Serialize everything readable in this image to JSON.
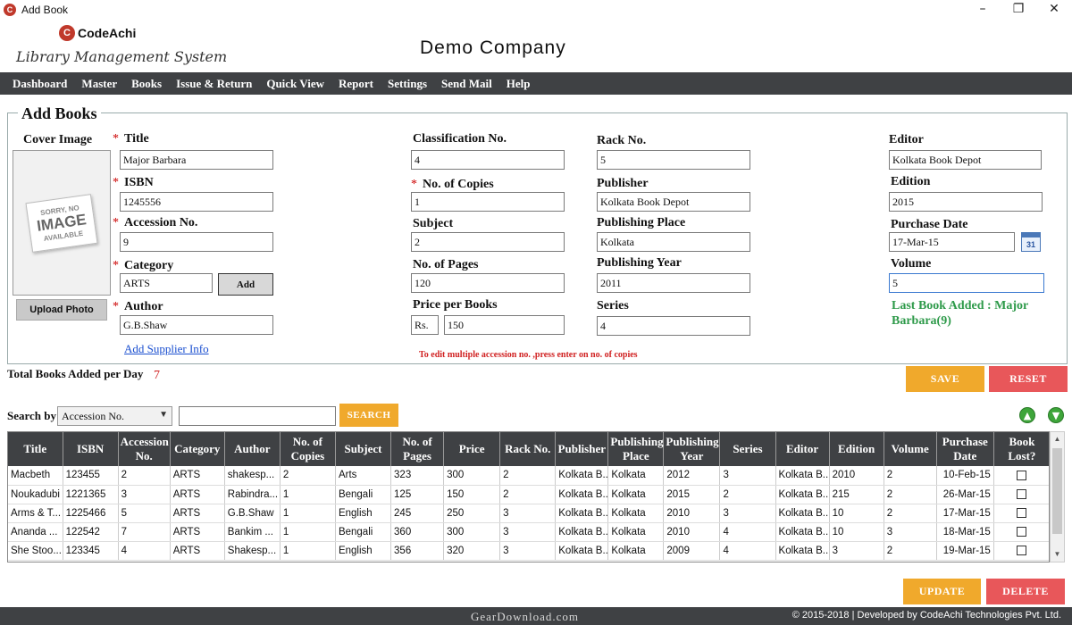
{
  "window": {
    "title": "Add Book",
    "minimize": "–",
    "maximize": "❐",
    "close": "✕"
  },
  "header": {
    "logo_brand": "CodeAchi",
    "logo_subtitle": "Library Management System",
    "company": "Demo Company"
  },
  "menu": [
    "Dashboard",
    "Master",
    "Books",
    "Issue & Return",
    "Quick View",
    "Report",
    "Settings",
    "Send Mail",
    "Help"
  ],
  "form": {
    "section_title": "Add Books",
    "cover_label": "Cover Image",
    "cover_placeholder": {
      "line1": "SORRY, NO",
      "line2": "IMAGE",
      "line3": "AVAILABLE"
    },
    "upload_photo": "Upload Photo",
    "required_mark": "*",
    "title_label": "Title",
    "title_value": "Major Barbara",
    "isbn_label": "ISBN",
    "isbn_value": "1245556",
    "accession_label": "Accession No.",
    "accession_value": "9",
    "category_label": "Category",
    "category_value": "ARTS",
    "add_label": "Add",
    "author_label": "Author",
    "author_value": "G.B.Shaw",
    "supplier_link": "Add Supplier Info",
    "classification_label": "Classification No.",
    "classification_value": "4",
    "copies_label": "No. of Copies",
    "copies_value": "1",
    "subject_label": "Subject",
    "subject_value": "2",
    "pages_label": "No. of Pages",
    "pages_value": "120",
    "price_label": "Price per Books",
    "currency": "Rs.",
    "price_value": "150",
    "rack_label": "Rack No.",
    "rack_value": "5",
    "publisher_label": "Publisher",
    "publisher_value": "Kolkata Book Depot",
    "place_label": "Publishing Place",
    "place_value": "Kolkata",
    "year_label": "Publishing Year",
    "year_value": "2011",
    "series_label": "Series",
    "series_value": "4",
    "editor_label": "Editor",
    "editor_value": "Kolkata Book Depot",
    "edition_label": "Edition",
    "edition_value": "2015",
    "purchase_label": "Purchase Date",
    "purchase_value": "17-Mar-15",
    "calendar_day": "31",
    "volume_label": "Volume",
    "volume_value": "5",
    "last_added": "Last Book Added : Major Barbara(9)",
    "hint": "To edit multiple accession no. ,press enter on no. of copies"
  },
  "stats": {
    "label": "Total Books Added per Day",
    "value": "7"
  },
  "actions": {
    "save": "SAVE",
    "reset": "RESET",
    "update": "UPDATE",
    "delete": "DELETE"
  },
  "search": {
    "label": "Search by",
    "field": "Accession No.",
    "query": "",
    "button": "SEARCH"
  },
  "table": {
    "columns": [
      "Title",
      "ISBN",
      "Accession No.",
      "Category",
      "Author",
      "No. of Copies",
      "Subject",
      "No. of Pages",
      "Price",
      "Rack No.",
      "Publisher",
      "Publishing Place",
      "Publishing Year",
      "Series",
      "Editor",
      "Edition",
      "Volume",
      "Purchase Date",
      "Book Lost?"
    ],
    "rows": [
      [
        "Macbeth",
        "123455",
        "2",
        "ARTS",
        "shakesp...",
        "2",
        "Arts",
        "323",
        "300",
        "2",
        "Kolkata B...",
        "Kolkata",
        "2012",
        "3",
        "Kolkata B...",
        "2010",
        "2",
        "10-Feb-15"
      ],
      [
        "Noukadubi",
        "1221365",
        "3",
        "ARTS",
        "Rabindra...",
        "1",
        "Bengali",
        "125",
        "150",
        "2",
        "Kolkata B...",
        "Kolkata",
        "2015",
        "2",
        "Kolkata B...",
        "215",
        "2",
        "26-Mar-15"
      ],
      [
        "Arms & T...",
        "1225466",
        "5",
        "ARTS",
        "G.B.Shaw",
        "1",
        "English",
        "245",
        "250",
        "3",
        "Kolkata B...",
        "Kolkata",
        "2010",
        "3",
        "Kolkata B...",
        "10",
        "2",
        "17-Mar-15"
      ],
      [
        "Ananda ...",
        "122542",
        "7",
        "ARTS",
        "Bankim ...",
        "1",
        "Bengali",
        "360",
        "300",
        "3",
        "Kolkata B...",
        "Kolkata",
        "2010",
        "4",
        "Kolkata B...",
        "10",
        "3",
        "18-Mar-15"
      ],
      [
        "She Stoo...",
        "123345",
        "4",
        "ARTS",
        "Shakesp...",
        "1",
        "English",
        "356",
        "320",
        "3",
        "Kolkata B...",
        "Kolkata",
        "2009",
        "4",
        "Kolkata B...",
        "3",
        "2",
        "19-Mar-15"
      ]
    ]
  },
  "footer": {
    "watermark": "GearDownload.com",
    "copyright": "© 2015-2018 | Developed by CodeAchi Technologies Pvt. Ltd."
  }
}
